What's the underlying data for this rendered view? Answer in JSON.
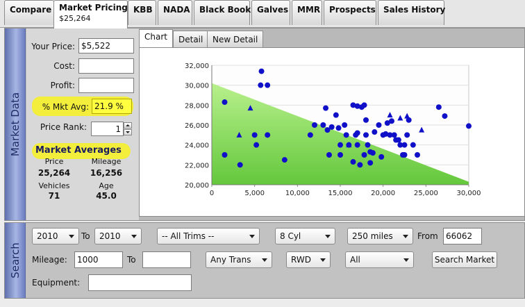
{
  "tabs": [
    {
      "label": "Compare"
    },
    {
      "label": "Market Pricing",
      "sub": "$25,264"
    },
    {
      "label": "KBB"
    },
    {
      "label": "NADA"
    },
    {
      "label": "Black Book"
    },
    {
      "label": "Galves"
    },
    {
      "label": "MMR"
    },
    {
      "label": "Prospects"
    },
    {
      "label": "Sales History"
    }
  ],
  "market_data": {
    "title": "Market Data",
    "your_price_label": "Your Price:",
    "your_price": "$5,522",
    "cost_label": "Cost:",
    "cost": "",
    "profit_label": "Profit:",
    "profit": "",
    "pct_mkt_avg_label": "% Mkt Avg:",
    "pct_mkt_avg": "21.9 %",
    "price_rank_label": "Price Rank:",
    "price_rank": "1",
    "averages_title": "Market Averages",
    "price_label": "Price",
    "price": "25,264",
    "mileage_label": "Mileage",
    "mileage": "16,256",
    "vehicles_label": "Vehicles",
    "vehicles": "71",
    "age_label": "Age",
    "age": "45.0"
  },
  "chart_tabs": [
    {
      "label": "Chart"
    },
    {
      "label": "Detail"
    },
    {
      "label": "New Detail"
    }
  ],
  "chart_data": {
    "type": "scatter",
    "xlim": [
      0,
      30000
    ],
    "ylim": [
      20000,
      32000
    ],
    "x_ticks": [
      0,
      5000,
      10000,
      15000,
      20000,
      25000,
      30000
    ],
    "x_tick_labels": [
      "0",
      "5,000",
      "10,000",
      "15,000",
      "20,000",
      "25,000",
      "30,000"
    ],
    "y_ticks": [
      20000,
      22000,
      24000,
      26000,
      28000,
      30000,
      32000
    ],
    "y_tick_labels": [
      "20,000",
      "22,000",
      "24,000",
      "26,000",
      "28,000",
      "30,000",
      "32,000"
    ],
    "grid": true,
    "band": {
      "start": [
        0,
        30200
      ],
      "end": [
        30000,
        20300
      ]
    },
    "point_color": "#1010c8",
    "band_colors": [
      "#b8f08c",
      "#64c83c"
    ],
    "series": [
      {
        "marker": "circle",
        "points": [
          [
            1500,
            28300
          ],
          [
            1500,
            23000
          ],
          [
            3300,
            22000
          ],
          [
            5000,
            25000
          ],
          [
            5200,
            24000
          ],
          [
            5800,
            31400
          ],
          [
            5700,
            30000
          ],
          [
            6500,
            30000
          ],
          [
            6500,
            25000
          ],
          [
            8500,
            22500
          ],
          [
            11500,
            25000
          ],
          [
            12000,
            26000
          ],
          [
            13000,
            26000
          ],
          [
            13300,
            27700
          ],
          [
            13500,
            25500
          ],
          [
            13700,
            23000
          ],
          [
            14000,
            25800
          ],
          [
            14500,
            27000
          ],
          [
            14800,
            25700
          ],
          [
            15000,
            24000
          ],
          [
            15000,
            23000
          ],
          [
            15500,
            26000
          ],
          [
            15700,
            25000
          ],
          [
            16000,
            24000
          ],
          [
            16500,
            22300
          ],
          [
            16500,
            28000
          ],
          [
            16800,
            25000
          ],
          [
            17000,
            27900
          ],
          [
            17000,
            25200
          ],
          [
            17000,
            24000
          ],
          [
            17300,
            22000
          ],
          [
            17500,
            27800
          ],
          [
            17800,
            28000
          ],
          [
            17800,
            23000
          ],
          [
            18000,
            26500
          ],
          [
            18000,
            25000
          ],
          [
            18200,
            24000
          ],
          [
            18500,
            23300
          ],
          [
            18500,
            22200
          ],
          [
            18800,
            23200
          ],
          [
            19000,
            25300
          ],
          [
            19500,
            26000
          ],
          [
            19800,
            22800
          ],
          [
            20000,
            25000
          ],
          [
            20300,
            25100
          ],
          [
            20500,
            26200
          ],
          [
            20800,
            25000
          ],
          [
            21000,
            26400
          ],
          [
            21300,
            25000
          ],
          [
            21500,
            24500
          ],
          [
            21800,
            24500
          ],
          [
            22000,
            24000
          ],
          [
            22300,
            23000
          ],
          [
            22500,
            24000
          ],
          [
            22500,
            23000
          ],
          [
            22800,
            25000
          ],
          [
            23000,
            26500
          ],
          [
            23500,
            24000
          ],
          [
            24000,
            23000
          ],
          [
            26500,
            27800
          ],
          [
            27200,
            26900
          ],
          [
            30000,
            25900
          ]
        ]
      },
      {
        "marker": "triangle",
        "points": [
          [
            3200,
            25000
          ],
          [
            4500,
            27700
          ],
          [
            16000,
            24000
          ],
          [
            20800,
            27000
          ],
          [
            22000,
            26700
          ],
          [
            22800,
            26900
          ],
          [
            24500,
            25500
          ]
        ]
      }
    ]
  },
  "search": {
    "title": "Search",
    "year_from": "2010",
    "to_label": "To",
    "year_to": "2010",
    "trims": "-- All Trims --",
    "cylinders": "8 Cyl",
    "radius": "250 miles",
    "from_label": "From",
    "zip": "66062",
    "mileage_label": "Mileage:",
    "mileage_from": "1000",
    "mileage_to_label": "To",
    "mileage_to": "",
    "transmission": "Any Trans",
    "drive": "RWD",
    "other": "All",
    "search_button": "Search Market",
    "equipment_label": "Equipment:",
    "equipment": ""
  }
}
